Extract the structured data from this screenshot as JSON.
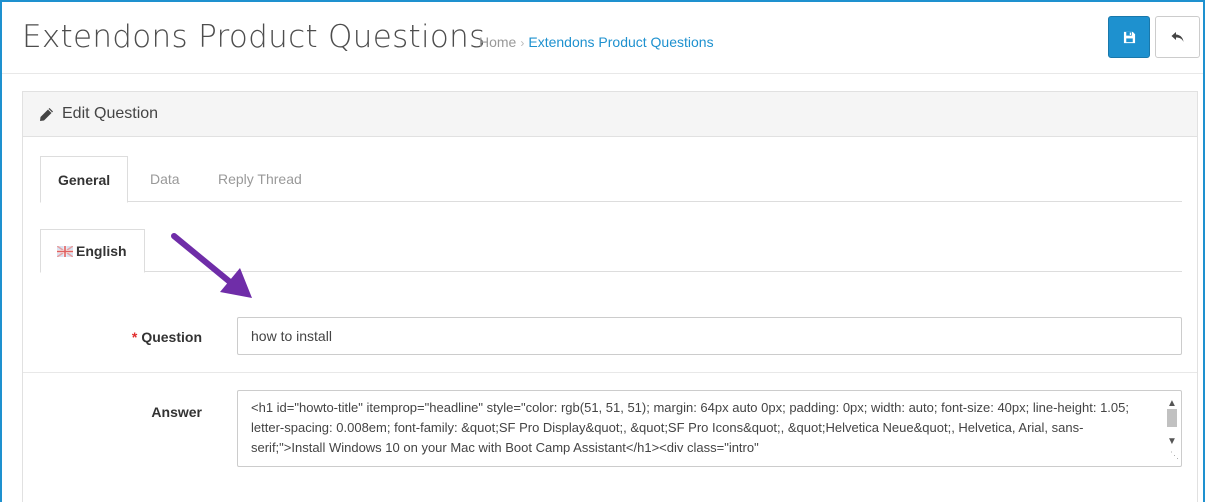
{
  "header": {
    "title": "Extendons Product Questions",
    "breadcrumb": {
      "home": "Home",
      "separator": "›",
      "current": "Extendons Product Questions"
    },
    "save_icon": "save-icon",
    "back_icon": "reply-icon"
  },
  "panel": {
    "icon": "pencil-icon",
    "title": "Edit Question"
  },
  "tabs": [
    {
      "label": "General",
      "active": true
    },
    {
      "label": "Data",
      "active": false
    },
    {
      "label": "Reply Thread",
      "active": false
    }
  ],
  "language_tab": {
    "label": "English",
    "icon": "uk-flag-icon"
  },
  "form": {
    "question_required_mark": "*",
    "question_label": "Question",
    "question_value": "how to install",
    "answer_label": "Answer",
    "answer_value": "<h1 id=\"howto-title\" itemprop=\"headline\" style=\"color: rgb(51, 51, 51); margin: 64px auto 0px; padding: 0px; width: auto; font-size: 40px; line-height: 1.05; letter-spacing: 0.008em; font-family: &quot;SF Pro Display&quot;, &quot;SF Pro Icons&quot;, &quot;Helvetica Neue&quot;, Helvetica, Arial, sans-serif;\">Install Windows 10 on your Mac with Boot Camp Assistant</h1><div class=\"intro\""
  },
  "colors": {
    "primary": "#1e91cf",
    "annotation_arrow": "#6f2da8",
    "required": "#e12d2d"
  }
}
